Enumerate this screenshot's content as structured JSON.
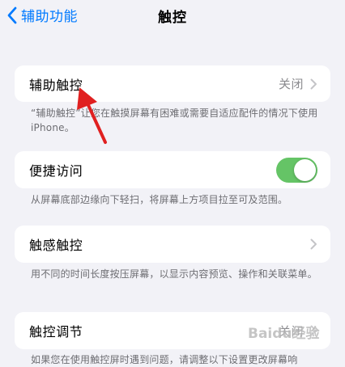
{
  "nav": {
    "back_label": "辅助功能",
    "title": "触控"
  },
  "cells": [
    {
      "label": "辅助触控",
      "value": "关闭"
    },
    {
      "label": "便捷访问",
      "toggle_on": true
    },
    {
      "label": "触感触控"
    },
    {
      "label": "触控调节",
      "value": "关闭"
    }
  ],
  "footers": [
    "“辅助触控”让您在触摸屏幕有困难或需要自适应配件的情况下使用iPhone。",
    "从屏幕底部边缘向下轻扫，将屏幕上方项目拉至可及范围。",
    "用不同的时间长度按压屏幕，以显示内容预览、操作和关联菜单。",
    "如果您在使用触控屏时遇到问题，请调整以下设置更改屏幕响"
  ],
  "watermark": "Baidu经验",
  "colors": {
    "accent": "#007aff",
    "toggle_on": "#65c466",
    "arrow": "#e02020"
  },
  "icons": {
    "back": "chevron-left-icon",
    "disclosure": "chevron-right-icon",
    "annotation": "red-arrow-annotation"
  }
}
